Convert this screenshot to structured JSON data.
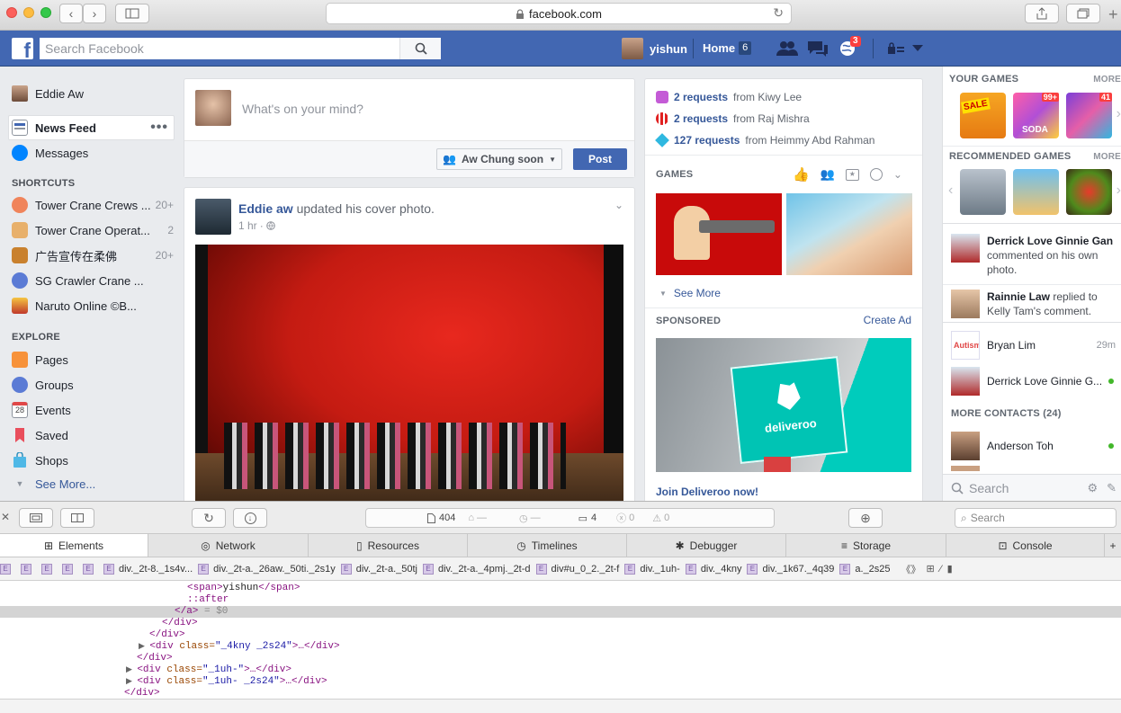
{
  "browser": {
    "url": "facebook.com"
  },
  "topbar": {
    "search_placeholder": "Search Facebook",
    "user_name": "yishun",
    "home_label": "Home",
    "home_count": "6",
    "notif_count": "3"
  },
  "left_nav": {
    "profile_name": "Eddie Aw",
    "items": [
      {
        "label": "News Feed"
      },
      {
        "label": "Messages"
      }
    ],
    "shortcuts_title": "SHORTCUTS",
    "shortcuts": [
      {
        "label": "Tower Crane Crews ...",
        "count": "20+"
      },
      {
        "label": "Tower Crane Operat...",
        "count": "2"
      },
      {
        "label": "广告宣传在柔佛",
        "count": "20+"
      },
      {
        "label": "SG Crawler Crane ...",
        "count": ""
      },
      {
        "label": "Naruto Online ©B...",
        "count": ""
      }
    ],
    "explore_title": "EXPLORE",
    "explore": [
      {
        "label": "Pages"
      },
      {
        "label": "Groups"
      },
      {
        "label": "Events"
      },
      {
        "label": "Saved"
      },
      {
        "label": "Shops"
      }
    ],
    "see_more": "See More...",
    "events_day": "28"
  },
  "composer": {
    "placeholder": "What's on your mind?",
    "audience": "Aw Chung soon",
    "post_label": "Post"
  },
  "feed_post": {
    "author": "Eddie aw",
    "action": "updated his cover photo.",
    "time": "1 hr"
  },
  "requests": [
    {
      "count": "2 requests",
      "from": "from Kiwy Lee"
    },
    {
      "count": "2 requests",
      "from": "from Raj Mishra"
    },
    {
      "count": "127 requests",
      "from": "from Heimmy Abd Rahman"
    }
  ],
  "games": {
    "title": "GAMES",
    "see_more": "See More"
  },
  "sponsored": {
    "title": "SPONSORED",
    "create_ad": "Create Ad",
    "brand_text": "deliveroo",
    "cta": "Join Deliveroo now!"
  },
  "sidebar": {
    "your_games": "YOUR GAMES",
    "more1": "MORE",
    "recommended": "RECOMMENDED GAMES",
    "more2": "MORE",
    "game_badge1": "99+",
    "game_badge2": "41",
    "sale_label": "SALE",
    "soda_label": "SODA",
    "ticker": [
      {
        "name": "Derrick Love Ginnie Gan",
        "text": "commented on his own photo."
      },
      {
        "name": "Rainnie Law",
        "text": "replied to Kelly Tam's comment."
      }
    ],
    "contacts": [
      {
        "name": "Bryan Lim",
        "meta": "29m"
      },
      {
        "name": "Derrick Love Ginnie G...",
        "meta": ""
      }
    ],
    "more_contacts": "MORE CONTACTS (24)",
    "contact3": "Anderson Toh",
    "search_placeholder": "Search",
    "autism_label": "Autism"
  },
  "devtools": {
    "stats": {
      "resources": "404",
      "messages": "4",
      "errors": "0",
      "warnings": "0",
      "dash1": "—",
      "dash2": "—"
    },
    "search_placeholder": "Search",
    "tabs": [
      "Elements",
      "Network",
      "Resources",
      "Timelines",
      "Debugger",
      "Storage",
      "Console"
    ],
    "crumbs": [
      "div._2t-8._1s4v...",
      "div._2t-a._26aw._50ti._2s1y",
      "div._2t-a._50tj",
      "div._2t-a._4pmj._2t-d",
      "div#u_0_2._2t-f",
      "div._1uh-",
      "div._4kny",
      "div._1k67._4q39",
      "a._2s25"
    ],
    "dom": {
      "l1a": "<span>",
      "l1b": "yishun",
      "l1c": "</span>",
      "l2": "::after",
      "l3": "</a>",
      "l3b": " = $0",
      "l4": "</div>",
      "l5": "</div>",
      "l6": "<div",
      "l6attr": " class=",
      "l6val": "\"_4kny _2s24\"",
      "l6end": ">…</div>",
      "l7": "</div>",
      "l8": "<div",
      "l8attr": " class=",
      "l8val": "\"_1uh-\"",
      "l8end": ">…</div>",
      "l9": "<div",
      "l9attr": " class=",
      "l9val": "\"_1uh- _2s24\"",
      "l9end": ">…</div>",
      "l10": "</div>"
    }
  }
}
